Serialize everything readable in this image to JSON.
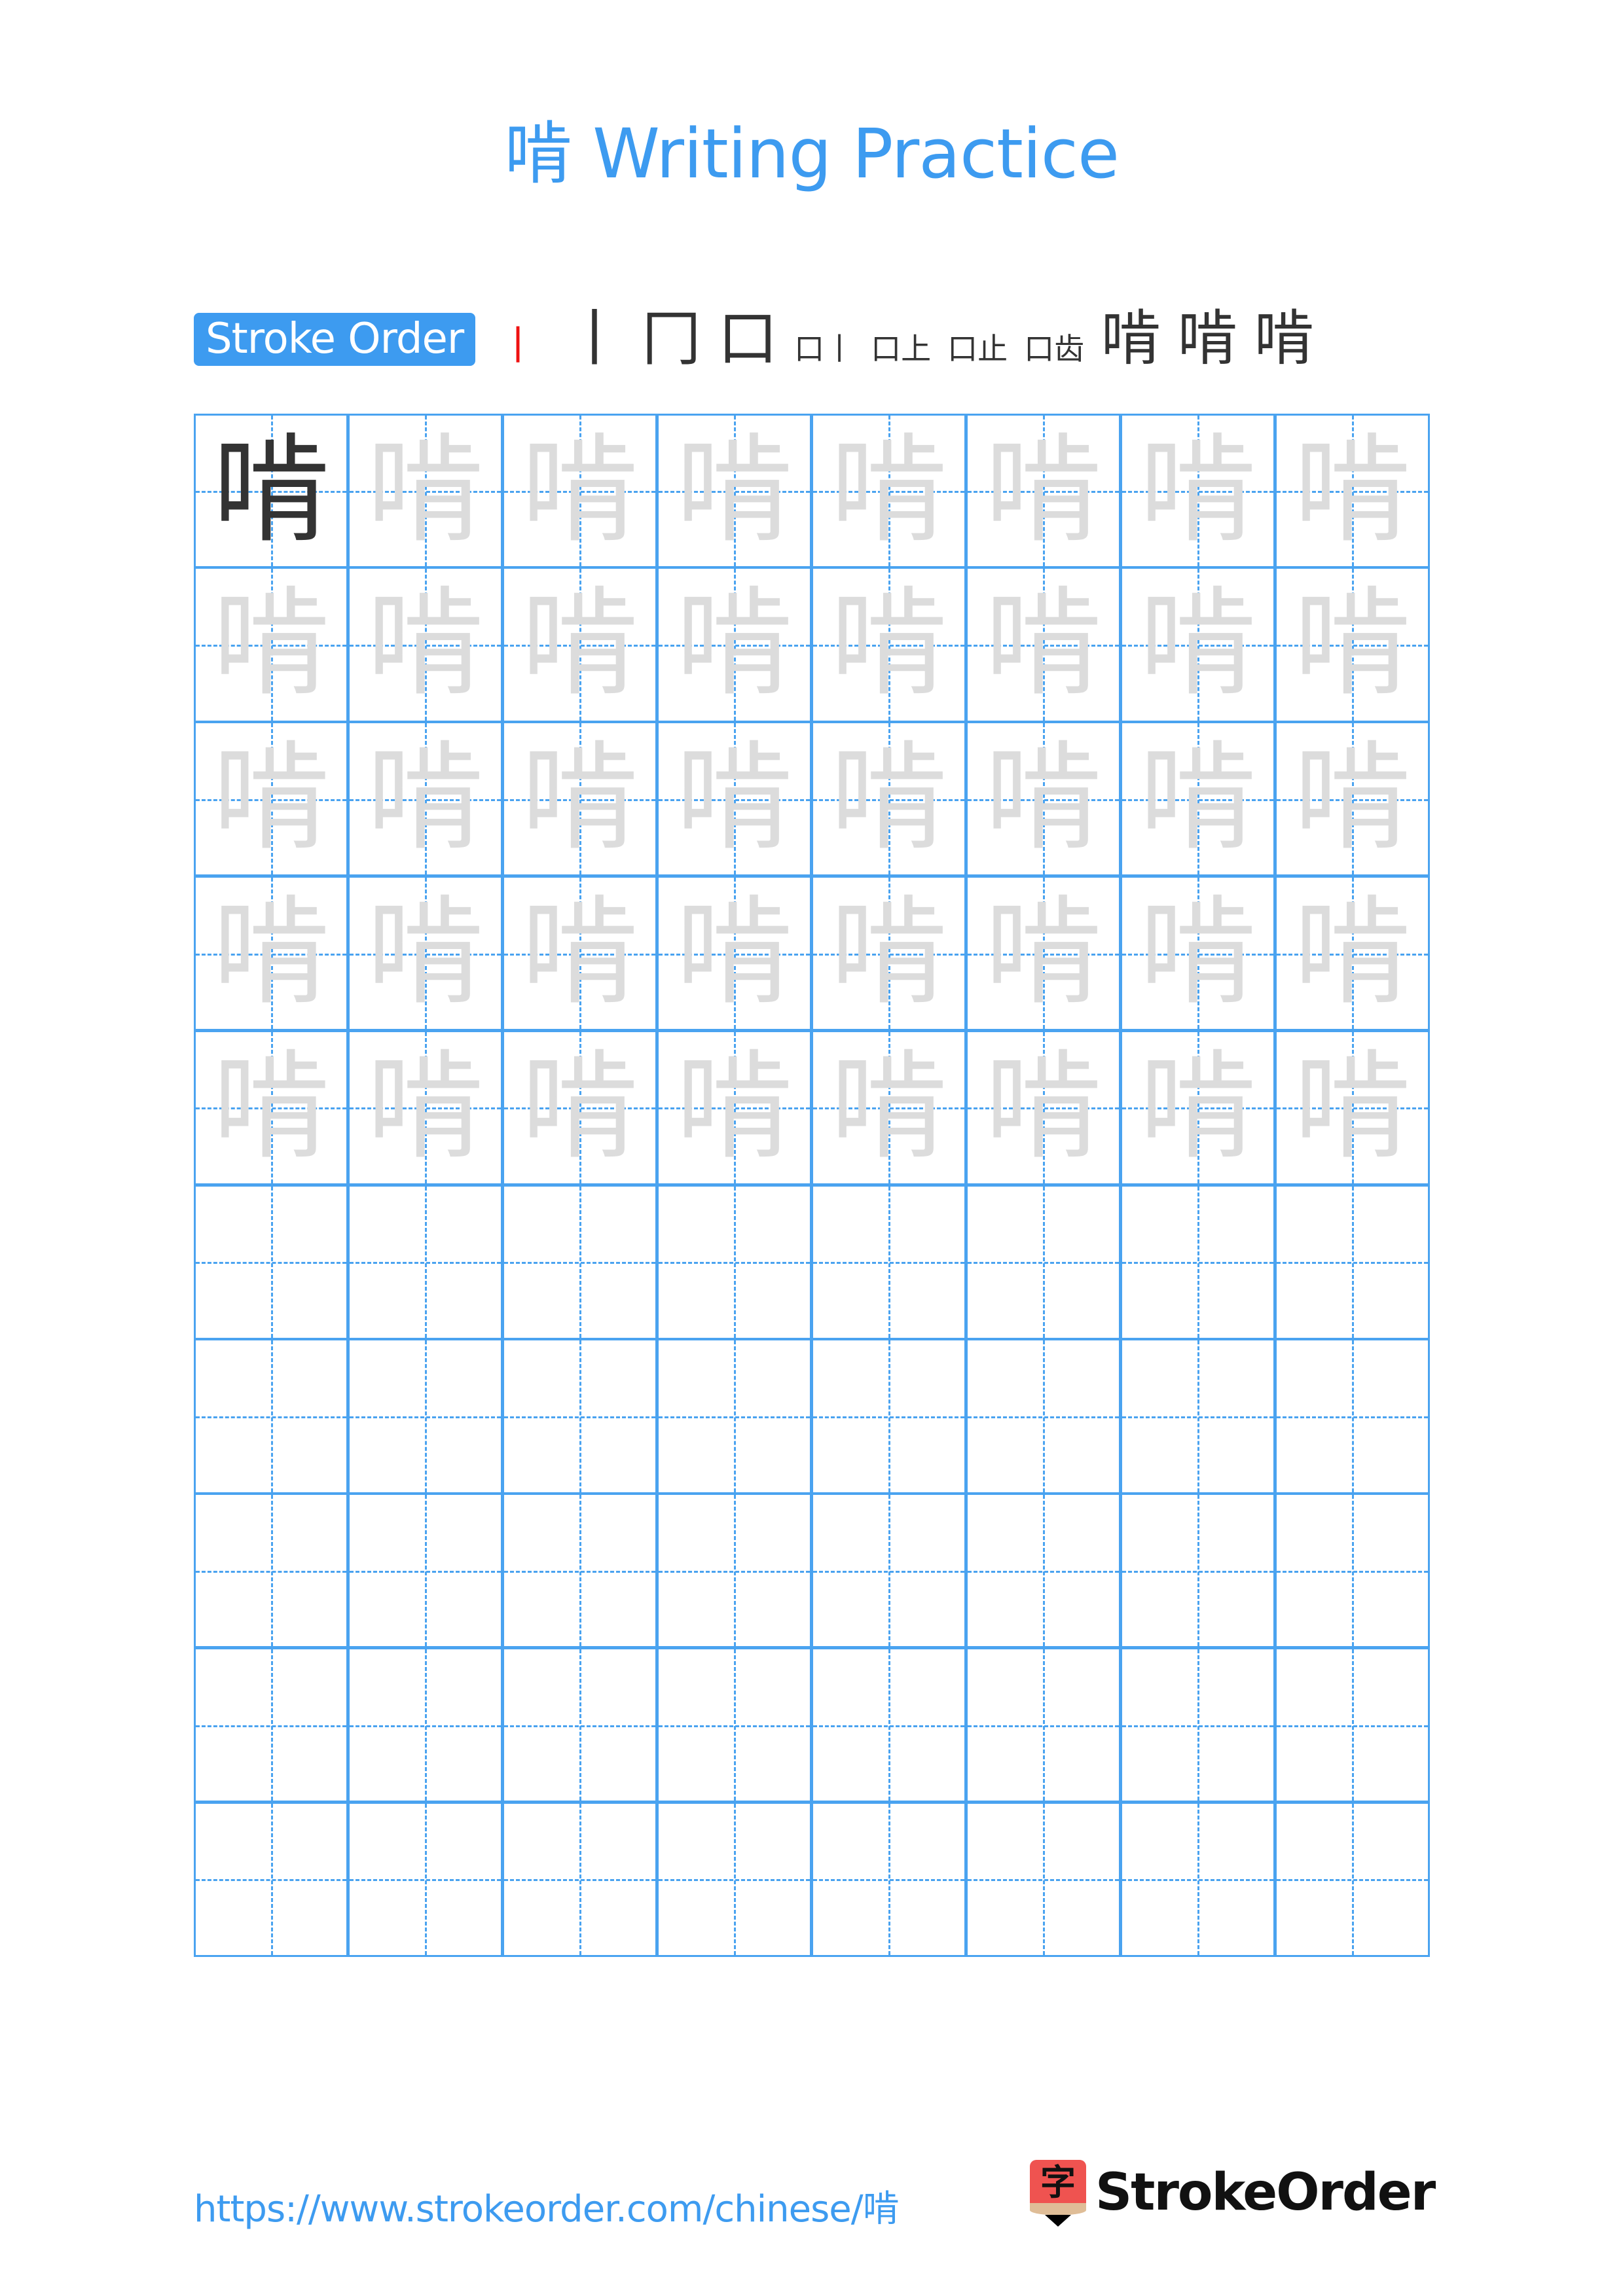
{
  "page": {
    "title": "啃 Writing Practice",
    "character": "啃",
    "colors": {
      "accent": "#3d9bf0",
      "grid": "#4aa3f0",
      "trace": "#dcdcdc",
      "model": "#333333",
      "highlight": "#ee1111"
    }
  },
  "stroke_order": {
    "label": "Stroke Order",
    "total_strokes": 11,
    "steps": [
      {
        "done": "",
        "new": "丨"
      },
      {
        "done": "丨",
        "new": "𠃍"
      },
      {
        "done": "冂",
        "new": "一"
      },
      {
        "done": "口",
        "new": "丨"
      },
      {
        "done": "口丨",
        "new": "一"
      },
      {
        "done": "口上",
        "new": "丶"
      },
      {
        "done": "口止",
        "new": "一"
      },
      {
        "done": "口齿",
        "new": "丿"
      },
      {
        "done": "啃",
        "new": "𠃌"
      },
      {
        "done": "啃",
        "new": "一"
      },
      {
        "done": "啃",
        "new": "一"
      }
    ]
  },
  "practice_grid": {
    "columns": 8,
    "rows": 10,
    "model_cells": 1,
    "trace_rows": 5
  },
  "footer": {
    "url": "https://www.strokeorder.com/chinese/啃",
    "logo_char": "字",
    "logo_text": "StrokeOrder"
  }
}
